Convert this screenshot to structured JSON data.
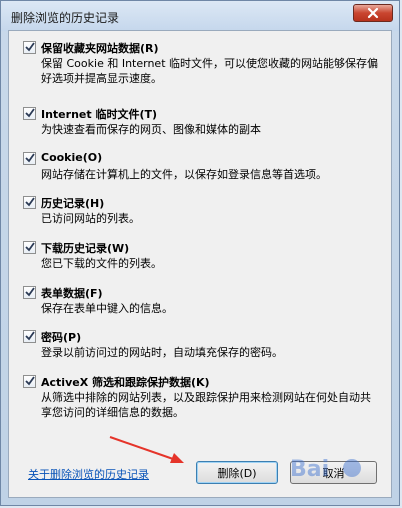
{
  "window": {
    "title": "删除浏览的历史记录"
  },
  "options": [
    {
      "checked": true,
      "title": "保留收藏夹网站数据(R)",
      "desc": "保留 Cookie 和 Internet 临时文件，可以使您收藏的网站能够保存偏好选项并提高显示速度。"
    },
    {
      "checked": true,
      "title": "Internet 临时文件(T)",
      "desc": "为快速查看而保存的网页、图像和媒体的副本"
    },
    {
      "checked": true,
      "title": "Cookie(O)",
      "desc": "网站存储在计算机上的文件，以保存如登录信息等首选项。"
    },
    {
      "checked": true,
      "title": "历史记录(H)",
      "desc": "已访问网站的列表。"
    },
    {
      "checked": true,
      "title": "下载历史记录(W)",
      "desc": "您已下载的文件的列表。"
    },
    {
      "checked": true,
      "title": "表单数据(F)",
      "desc": "保存在表单中键入的信息。"
    },
    {
      "checked": true,
      "title": "密码(P)",
      "desc": "登录以前访问过的网站时，自动填充保存的密码。"
    },
    {
      "checked": true,
      "title": "ActiveX 筛选和跟踪保护数据(K)",
      "desc": "从筛选中排除的网站列表，以及跟踪保护用来检测网站在何处自动共享您访问的详细信息的数据。"
    }
  ],
  "footer": {
    "link": "关于删除浏览的历史记录",
    "delete_label": "删除(D)",
    "cancel_label": "取消"
  },
  "colors": {
    "link": "#0a54b8",
    "annotation_arrow": "#e5342a"
  }
}
